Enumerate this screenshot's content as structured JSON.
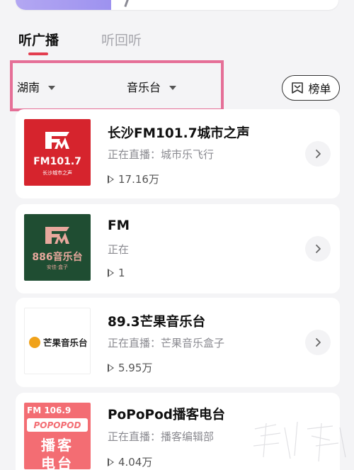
{
  "tabs": [
    {
      "label": "听广播",
      "active": true
    },
    {
      "label": "听回听",
      "active": false
    }
  ],
  "filters": {
    "region": "湖南",
    "type": "音乐台",
    "rank_label": "榜单"
  },
  "stations": [
    {
      "title": "长沙FM101.7城市之声",
      "status": "正在直播：城市乐飞行",
      "plays": "17.16万",
      "logo": {
        "main": "FM101.7",
        "sub": "长沙城市之声",
        "bg": "#d6242d"
      }
    },
    {
      "title": "FM",
      "status": "正在",
      "plays": "1",
      "logo": {
        "main": "886音乐台",
        "sub": "安佳·盒子",
        "bg": "#1f4d32"
      }
    },
    {
      "title": "89.3芒果音乐台",
      "status": "正在直播：芒果音乐盒子",
      "plays": "5.95万",
      "logo": {
        "main": "芒果音乐台",
        "bg": "#ffffff"
      }
    },
    {
      "title": "PoPoPod播客电台",
      "status": "正在直播：播客编辑部",
      "plays": "4.04万",
      "logo": {
        "head": "FM 106.9",
        "band": "POPOPOD",
        "big1": "播客",
        "big2": "电台",
        "bg": "#f36d73"
      }
    }
  ],
  "colors": {
    "accent": "#e33d4f",
    "highlight_frame": "#e56f97",
    "background": "#f4f4f6"
  }
}
